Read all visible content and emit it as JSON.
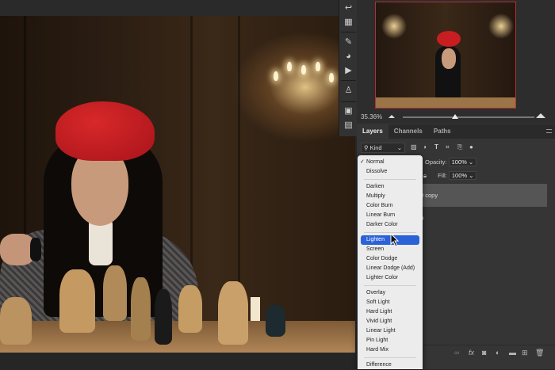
{
  "navigator": {
    "zoom": "35.36%"
  },
  "panel": {
    "tabs": [
      "Layers",
      "Channels",
      "Paths"
    ],
    "filter_kind": "Kind",
    "opacity_label": "Opacity:",
    "opacity_value": "100%",
    "fill_label": "Fill:",
    "fill_value": "100%",
    "layers": [
      {
        "name_fragment": "0 copy",
        "selected": true
      },
      {
        "name_fragment": "0",
        "selected": false
      }
    ]
  },
  "blend_menu": {
    "groups": [
      [
        "Normal",
        "Dissolve"
      ],
      [
        "Darken",
        "Multiply",
        "Color Burn",
        "Linear Burn",
        "Darker Color"
      ],
      [
        "Lighten",
        "Screen",
        "Color Dodge",
        "Linear Dodge (Add)",
        "Lighter Color"
      ],
      [
        "Overlay",
        "Soft Light",
        "Hard Light",
        "Vivid Light",
        "Linear Light",
        "Pin Light",
        "Hard Mix"
      ],
      [
        "Difference"
      ]
    ],
    "checked": "Normal",
    "highlighted": "Lighten"
  },
  "colors": {
    "highlight": "#2a62d8",
    "panel": "#353535",
    "beret": "#c81e22"
  }
}
